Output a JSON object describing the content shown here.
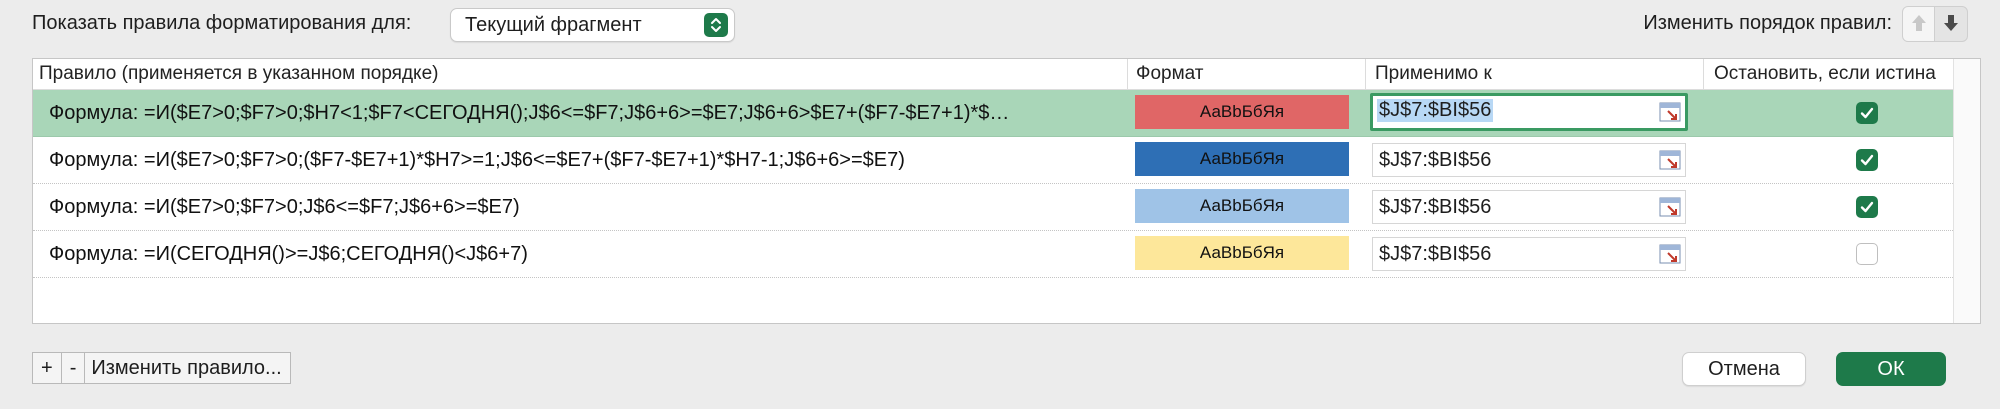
{
  "topbar": {
    "show_label": "Показать правила форматирования для:",
    "scope_value": "Текущий фрагмент",
    "order_label": "Изменить порядок правил:"
  },
  "table": {
    "headers": {
      "rule": "Правило (применяется в указанном порядке)",
      "format": "Формат",
      "applies_to": "Применимо к",
      "stop_if_true": "Остановить, если истина"
    },
    "rows": [
      {
        "rule": "Формула: =И($E7>0;$F7>0;$H7<1;$F7<СЕГОДНЯ();J$6<=$F7;J$6+6>=$E7;J$6+6>$E7+($F7-$E7+1)*$…",
        "format_sample": "АаВbБбЯя",
        "format_color": "#e06666",
        "applies_to": "$J$7:$BI$56",
        "stop_if_true": true,
        "selected": true
      },
      {
        "rule": "Формула: =И($E7>0;$F7>0;($F7-$E7+1)*$H7>=1;J$6<=$E7+($F7-$E7+1)*$H7-1;J$6+6>=$E7)",
        "format_sample": "АаВbБбЯя",
        "format_color": "#2e6fb5",
        "applies_to": "$J$7:$BI$56",
        "stop_if_true": true,
        "selected": false
      },
      {
        "rule": "Формула: =И($E7>0;$F7>0;J$6<=$F7;J$6+6>=$E7)",
        "format_sample": "АаВbБбЯя",
        "format_color": "#9fc3e7",
        "applies_to": "$J$7:$BI$56",
        "stop_if_true": true,
        "selected": false
      },
      {
        "rule": "Формула: =И(СЕГОДНЯ()>=J$6;СЕГОДНЯ()<J$6+7)",
        "format_sample": "АаВbБбЯя",
        "format_color": "#fde79a",
        "applies_to": "$J$7:$BI$56",
        "stop_if_true": false,
        "selected": false
      }
    ]
  },
  "bottombar": {
    "add_label": "+",
    "remove_label": "-",
    "edit_label": "Изменить правило...",
    "cancel_label": "Отмена",
    "ok_label": "ОК"
  },
  "icons": {
    "scope_stepper": "chevron-up-down-icon",
    "move_up": "arrow-up-icon",
    "move_down": "arrow-down-icon",
    "range_picker": "range-picker-icon",
    "checkbox": "checkmark-icon"
  },
  "colors": {
    "accent": "#1e7a4a",
    "selected_row": "#a9d6b8"
  }
}
